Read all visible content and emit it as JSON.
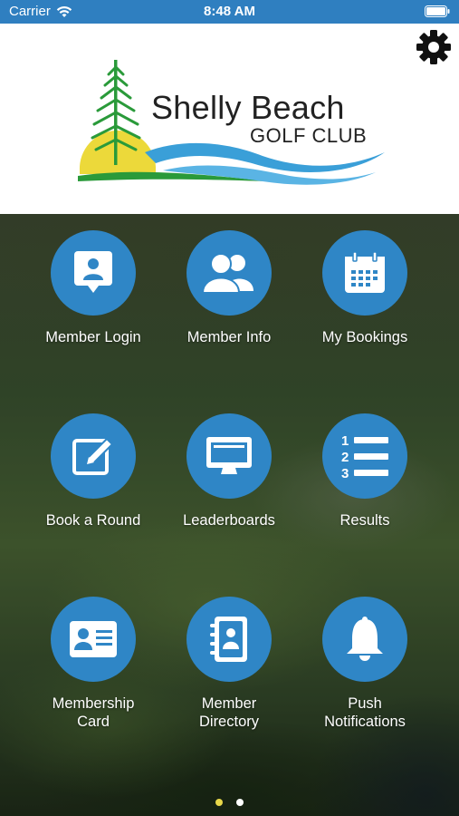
{
  "status_bar": {
    "carrier": "Carrier",
    "time": "8:48 AM",
    "icons": [
      "wifi-icon",
      "battery-icon"
    ]
  },
  "header": {
    "logo_title": "Shelly Beach",
    "logo_subtitle": "GOLF CLUB",
    "settings_icon": "gear-icon"
  },
  "menu": {
    "items": [
      {
        "label": "Member Login",
        "icon": "member-login-icon"
      },
      {
        "label": "Member Info",
        "icon": "members-icon"
      },
      {
        "label": "My Bookings",
        "icon": "calendar-icon"
      },
      {
        "label": "Book a Round",
        "icon": "edit-icon"
      },
      {
        "label": "Leaderboards",
        "icon": "monitor-icon"
      },
      {
        "label": "Results",
        "icon": "numbered-list-icon"
      },
      {
        "label": "Membership\nCard",
        "icon": "id-card-icon"
      },
      {
        "label": "Member\nDirectory",
        "icon": "address-book-icon"
      },
      {
        "label": "Push\nNotifications",
        "icon": "bell-icon"
      }
    ]
  },
  "pagination": {
    "pages": 2,
    "current": 1
  },
  "colors": {
    "status_bar": "#2f7fc0",
    "icon_circle": "#2f86c6",
    "active_dot": "#e8d84a"
  }
}
